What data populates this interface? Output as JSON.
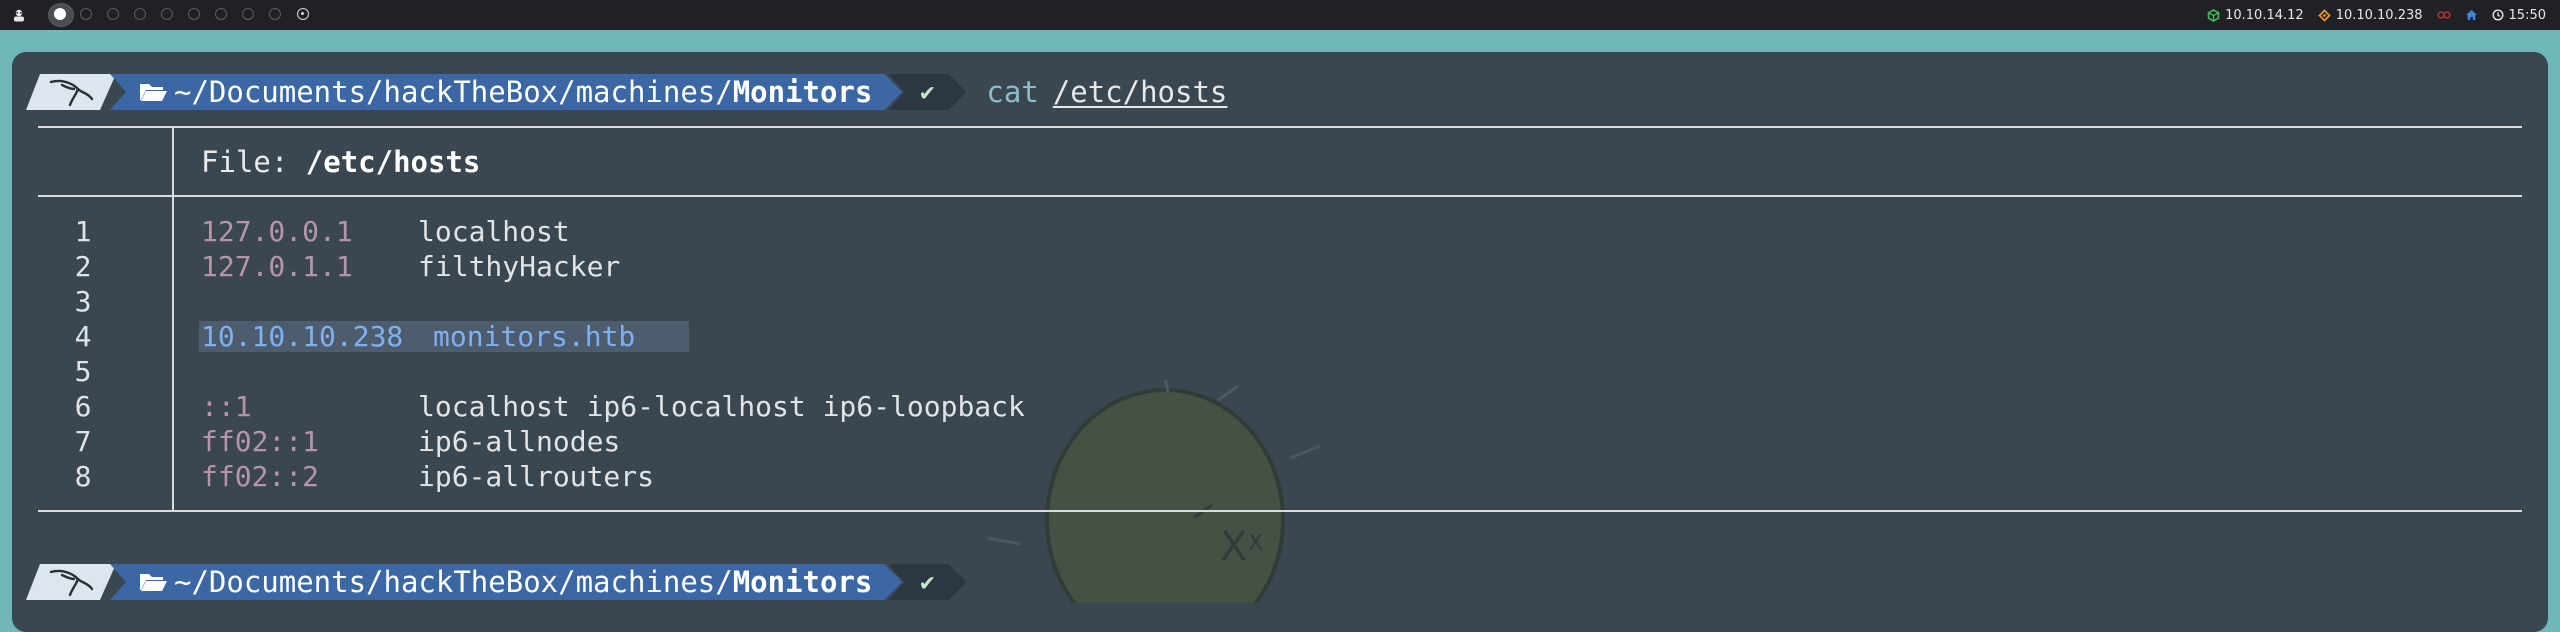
{
  "topbar": {
    "workspaces": [
      {
        "name": "workspace-1",
        "state": "active"
      },
      {
        "name": "workspace-2",
        "state": "empty"
      },
      {
        "name": "workspace-3",
        "state": "empty"
      },
      {
        "name": "workspace-4",
        "state": "empty"
      },
      {
        "name": "workspace-5",
        "state": "empty"
      },
      {
        "name": "workspace-6",
        "state": "empty"
      },
      {
        "name": "workspace-7",
        "state": "empty"
      },
      {
        "name": "workspace-8",
        "state": "empty"
      },
      {
        "name": "workspace-9",
        "state": "empty"
      },
      {
        "name": "workspace-10",
        "state": "target"
      }
    ],
    "vpn_ip": "10.10.14.12",
    "target_ip": "10.10.10.238",
    "clock": "15:50",
    "colors": {
      "vpn": "#3fbf5a",
      "target": "#e8942a",
      "status": "#d94a4a",
      "home": "#3a86e0"
    }
  },
  "prompt1": {
    "path_prefix": "~/Documents/hackTheBox/machines/",
    "path_dir": "Monitors",
    "status_glyph": "✔",
    "command": "cat",
    "argument": "/etc/hosts"
  },
  "file": {
    "label": "File:",
    "name": "/etc/hosts",
    "lines": [
      {
        "num": "1",
        "ip": "127.0.0.1",
        "host": "localhost"
      },
      {
        "num": "2",
        "ip": "127.0.1.1",
        "host": "filthyHacker"
      },
      {
        "num": "3",
        "ip": "",
        "host": ""
      },
      {
        "num": "4",
        "ip": "10.10.10.238",
        "host": "monitors.htb"
      },
      {
        "num": "5",
        "ip": "",
        "host": ""
      },
      {
        "num": "6",
        "ip": "::1",
        "host": "localhost ip6-localhost ip6-loopback"
      },
      {
        "num": "7",
        "ip": "ff02::1",
        "host": "ip6-allnodes"
      },
      {
        "num": "8",
        "ip": "ff02::2",
        "host": "ip6-allrouters"
      }
    ]
  },
  "prompt2": {
    "path_prefix": "~/Documents/hackTheBox/machines/",
    "path_dir": "Monitors",
    "status_glyph": "✔"
  }
}
